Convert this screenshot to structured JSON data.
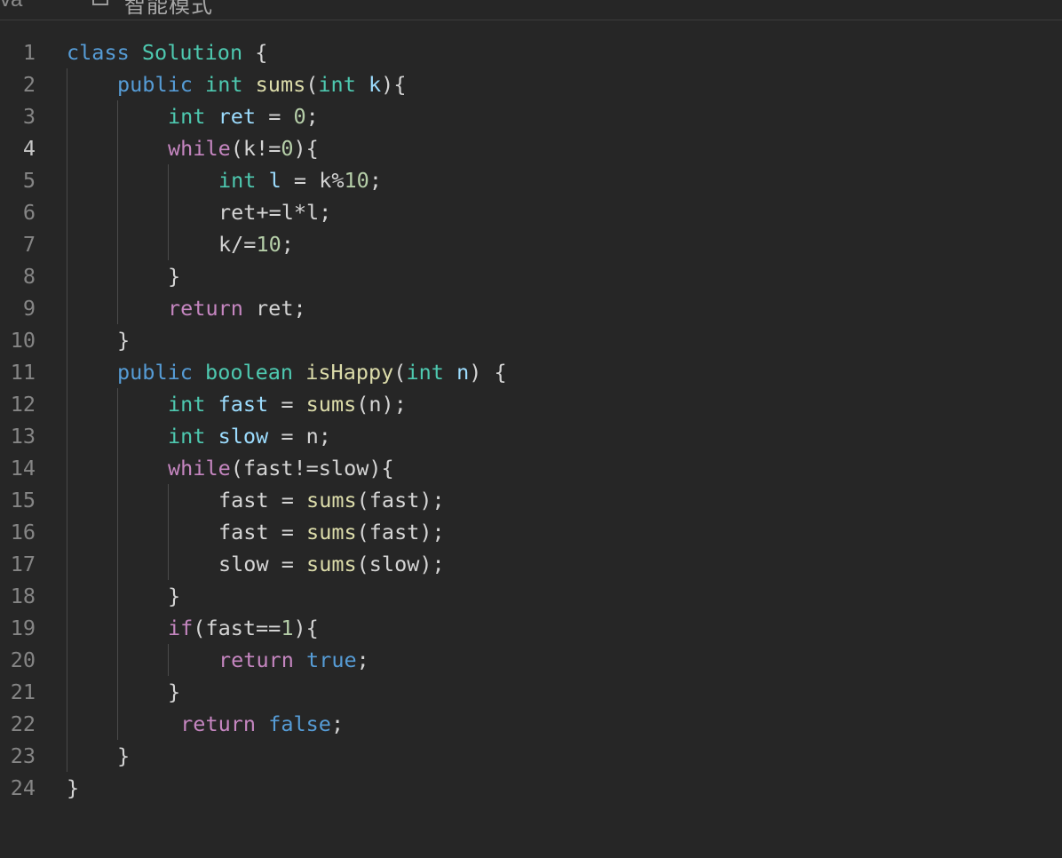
{
  "topbar": {
    "language_fragment": "va",
    "mode_label": "智能模式"
  },
  "editor": {
    "active_line": 4,
    "lines": [
      {
        "n": "1",
        "indent": 0,
        "tokens": [
          [
            "kw",
            "class"
          ],
          [
            "p",
            " "
          ],
          [
            "cls",
            "Solution"
          ],
          [
            "p",
            " {"
          ]
        ]
      },
      {
        "n": "2",
        "indent": 1,
        "tokens": [
          [
            "kw",
            "public"
          ],
          [
            "p",
            " "
          ],
          [
            "ty",
            "int"
          ],
          [
            "p",
            " "
          ],
          [
            "fn",
            "sums"
          ],
          [
            "p",
            "("
          ],
          [
            "ty",
            "int"
          ],
          [
            "p",
            " "
          ],
          [
            "var",
            "k"
          ],
          [
            "p",
            "){"
          ]
        ]
      },
      {
        "n": "3",
        "indent": 2,
        "tokens": [
          [
            "ty",
            "int"
          ],
          [
            "p",
            " "
          ],
          [
            "var",
            "ret"
          ],
          [
            "p",
            " = "
          ],
          [
            "num",
            "0"
          ],
          [
            "p",
            ";"
          ]
        ]
      },
      {
        "n": "4",
        "indent": 2,
        "tokens": [
          [
            "ctl",
            "while"
          ],
          [
            "p",
            "(k!="
          ],
          [
            "num",
            "0"
          ],
          [
            "p",
            "){"
          ]
        ]
      },
      {
        "n": "5",
        "indent": 3,
        "tokens": [
          [
            "ty",
            "int"
          ],
          [
            "p",
            " "
          ],
          [
            "var",
            "l"
          ],
          [
            "p",
            " = k%"
          ],
          [
            "num",
            "10"
          ],
          [
            "p",
            ";"
          ]
        ]
      },
      {
        "n": "6",
        "indent": 3,
        "tokens": [
          [
            "p",
            "ret+=l*l;"
          ]
        ]
      },
      {
        "n": "7",
        "indent": 3,
        "tokens": [
          [
            "p",
            "k/="
          ],
          [
            "num",
            "10"
          ],
          [
            "p",
            ";"
          ]
        ]
      },
      {
        "n": "8",
        "indent": 2,
        "tokens": [
          [
            "p",
            "}"
          ]
        ]
      },
      {
        "n": "9",
        "indent": 2,
        "tokens": [
          [
            "ctl",
            "return"
          ],
          [
            "p",
            " ret;"
          ]
        ]
      },
      {
        "n": "10",
        "indent": 1,
        "tokens": [
          [
            "p",
            "}"
          ]
        ]
      },
      {
        "n": "11",
        "indent": 1,
        "tokens": [
          [
            "kw",
            "public"
          ],
          [
            "p",
            " "
          ],
          [
            "ty",
            "boolean"
          ],
          [
            "p",
            " "
          ],
          [
            "fn",
            "isHappy"
          ],
          [
            "p",
            "("
          ],
          [
            "ty",
            "int"
          ],
          [
            "p",
            " "
          ],
          [
            "var",
            "n"
          ],
          [
            "p",
            ") {"
          ]
        ]
      },
      {
        "n": "12",
        "indent": 2,
        "tokens": [
          [
            "ty",
            "int"
          ],
          [
            "p",
            " "
          ],
          [
            "var",
            "fast"
          ],
          [
            "p",
            " = "
          ],
          [
            "fn",
            "sums"
          ],
          [
            "p",
            "(n);"
          ]
        ]
      },
      {
        "n": "13",
        "indent": 2,
        "tokens": [
          [
            "ty",
            "int"
          ],
          [
            "p",
            " "
          ],
          [
            "var",
            "slow"
          ],
          [
            "p",
            " = n;"
          ]
        ]
      },
      {
        "n": "14",
        "indent": 2,
        "tokens": [
          [
            "ctl",
            "while"
          ],
          [
            "p",
            "(fast!=slow){"
          ]
        ]
      },
      {
        "n": "15",
        "indent": 3,
        "tokens": [
          [
            "p",
            "fast = "
          ],
          [
            "fn",
            "sums"
          ],
          [
            "p",
            "(fast);"
          ]
        ]
      },
      {
        "n": "16",
        "indent": 3,
        "tokens": [
          [
            "p",
            "fast = "
          ],
          [
            "fn",
            "sums"
          ],
          [
            "p",
            "(fast);"
          ]
        ]
      },
      {
        "n": "17",
        "indent": 3,
        "tokens": [
          [
            "p",
            "slow = "
          ],
          [
            "fn",
            "sums"
          ],
          [
            "p",
            "(slow);"
          ]
        ]
      },
      {
        "n": "18",
        "indent": 2,
        "tokens": [
          [
            "p",
            "}"
          ]
        ]
      },
      {
        "n": "19",
        "indent": 2,
        "tokens": [
          [
            "ctl",
            "if"
          ],
          [
            "p",
            "(fast=="
          ],
          [
            "num",
            "1"
          ],
          [
            "p",
            "){"
          ]
        ]
      },
      {
        "n": "20",
        "indent": 3,
        "tokens": [
          [
            "ctl",
            "return"
          ],
          [
            "p",
            " "
          ],
          [
            "lit",
            "true"
          ],
          [
            "p",
            ";"
          ]
        ]
      },
      {
        "n": "21",
        "indent": 2,
        "tokens": [
          [
            "p",
            "}"
          ]
        ]
      },
      {
        "n": "22",
        "indent": 2,
        "tokens": [
          [
            "p",
            " "
          ],
          [
            "ctl",
            "return"
          ],
          [
            "p",
            " "
          ],
          [
            "lit",
            "false"
          ],
          [
            "p",
            ";"
          ]
        ]
      },
      {
        "n": "23",
        "indent": 1,
        "tokens": [
          [
            "p",
            "}"
          ]
        ]
      },
      {
        "n": "24",
        "indent": 0,
        "tokens": [
          [
            "p",
            "}"
          ]
        ]
      }
    ]
  }
}
